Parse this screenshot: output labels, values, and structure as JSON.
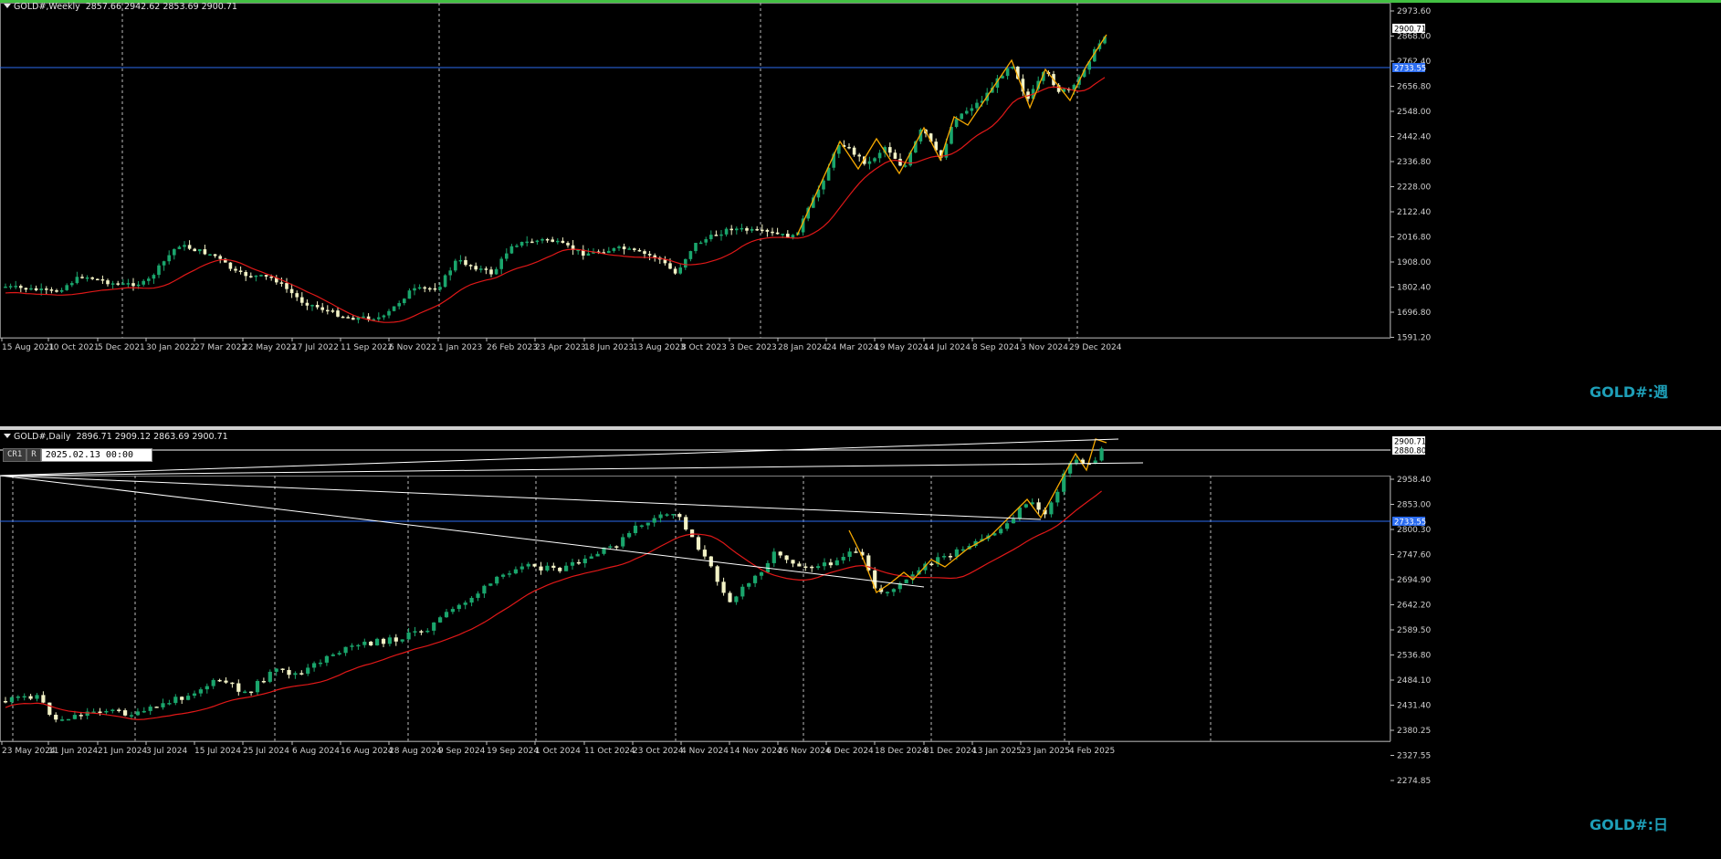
{
  "colors": {
    "bull": "#1aa56c",
    "bear": "#f2f2c6",
    "ma": "#e01818",
    "zigzag": "#f7a900",
    "hline": "#2b6cf0",
    "accent": "#43c043",
    "watermark": "#1e9fb8"
  },
  "weekly": {
    "title": "GOLD#,Weekly",
    "ohlc": "2857.66 2942.62 2853.69 2900.71",
    "watermark": "GOLD#:週",
    "price_labels": [
      "2973.60",
      "2868.00",
      "2762.40",
      "2656.80",
      "2548.00",
      "2442.40",
      "2336.80",
      "2228.00",
      "2122.40",
      "2016.80",
      "1908.00",
      "1802.40",
      "1696.80",
      "1591.20"
    ],
    "current_price": "2900.71",
    "level_price": "2733.55",
    "date_labels": [
      "15 Aug 2021",
      "10 Oct 2021",
      "5 Dec 2021",
      "30 Jan 2022",
      "27 Mar 2022",
      "22 May 2022",
      "17 Jul 2022",
      "11 Sep 2022",
      "6 Nov 2022",
      "1 Jan 2023",
      "26 Feb 2023",
      "23 Apr 2023",
      "18 Jun 2023",
      "13 Aug 2023",
      "8 Oct 2023",
      "3 Dec 2023",
      "28 Jan 2024",
      "24 Mar 2024",
      "19 May 2024",
      "14 Jul 2024",
      "8 Sep 2024",
      "3 Nov 2024",
      "29 Dec 2024"
    ]
  },
  "daily": {
    "title": "GOLD#,Daily",
    "ohlc": "2896.71 2909.12 2863.69 2900.71",
    "watermark": "GOLD#:日",
    "tool_cr": "CR1",
    "tool_r": "R",
    "tool_value": "2025.02.13 00:00",
    "price_labels": [
      "2958.40",
      "2853.00",
      "2800.30",
      "2747.60",
      "2694.90",
      "2642.20",
      "2589.50",
      "2536.80",
      "2484.10",
      "2431.40",
      "2380.25",
      "2327.55",
      "2274.85"
    ],
    "current_price": "2900.71",
    "line_price": "2880.80",
    "level_price": "2733.55",
    "date_labels": [
      "23 May 2024",
      "11 Jun 2024",
      "21 Jun 2024",
      "3 Jul 2024",
      "15 Jul 2024",
      "25 Jul 2024",
      "6 Aug 2024",
      "16 Aug 2024",
      "28 Aug 2024",
      "9 Sep 2024",
      "19 Sep 2024",
      "1 Oct 2024",
      "11 Oct 2024",
      "23 Oct 2024",
      "4 Nov 2024",
      "14 Nov 2024",
      "26 Nov 2024",
      "6 Dec 2024",
      "18 Dec 2024",
      "31 Dec 2024",
      "13 Jan 2025",
      "23 Jan 2025",
      "4 Feb 2025"
    ]
  }
}
